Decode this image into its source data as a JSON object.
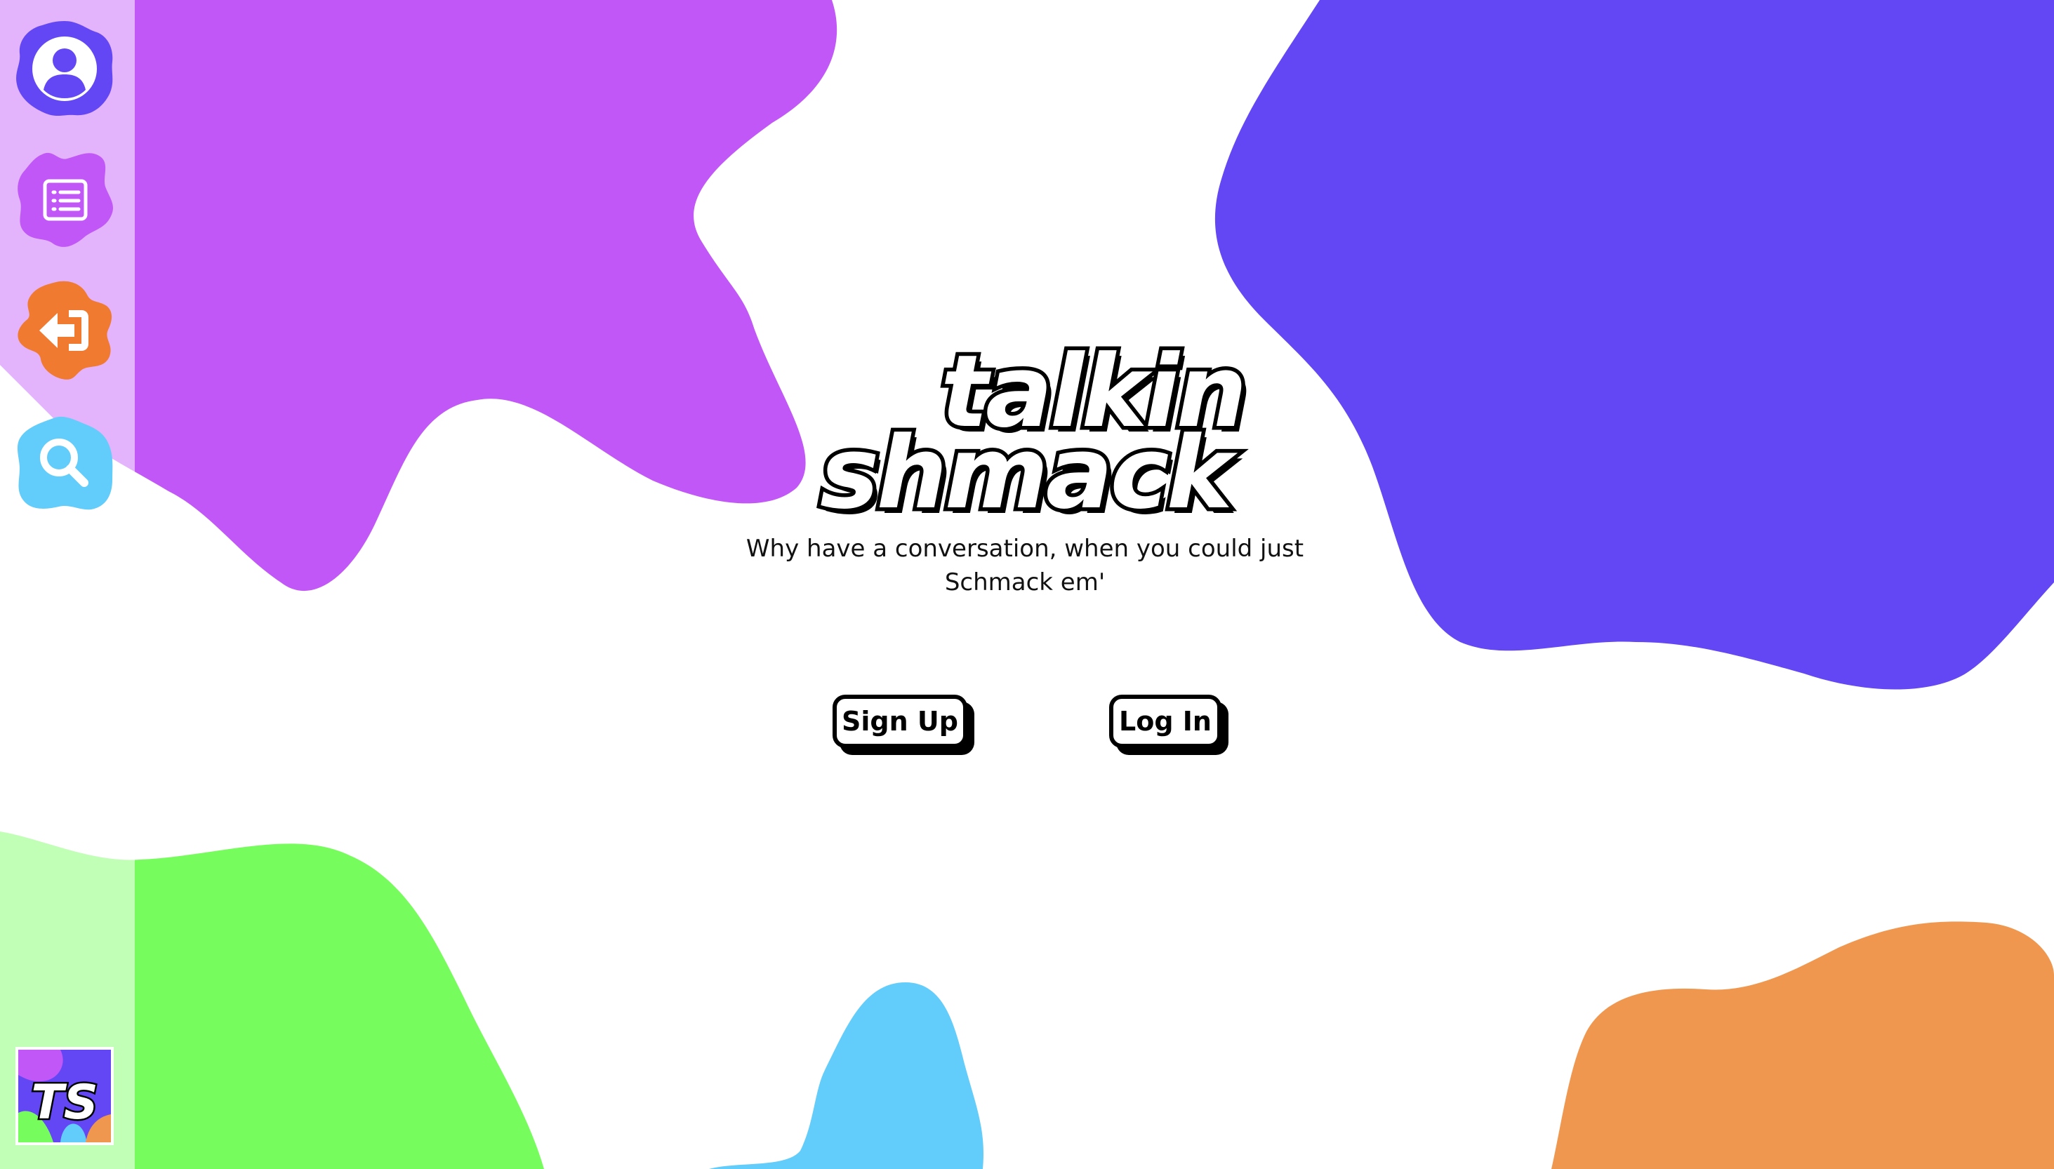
{
  "colors": {
    "purple": "#C157F7",
    "indigo": "#6447F4",
    "green": "#77FC5D",
    "sky": "#62CCFA",
    "orange": "#F0974F",
    "sidebar_tint": "rgba(255,255,255,0.55)"
  },
  "sidebar": {
    "items": [
      {
        "name": "profile",
        "icon": "user-icon",
        "color": "#6447F4"
      },
      {
        "name": "feed",
        "icon": "list-icon",
        "color": "#C157F7"
      },
      {
        "name": "logout",
        "icon": "exit-icon",
        "color": "#F07A30"
      },
      {
        "name": "search",
        "icon": "search-icon",
        "color": "#62CCFA"
      }
    ],
    "logo_text": "TS"
  },
  "hero": {
    "logo_line1": "talkin",
    "logo_line2": "shmack",
    "tagline_line1": "Why have a conversation, when you could just",
    "tagline_line2": "Schmack em'"
  },
  "actions": {
    "signup_label": "Sign Up",
    "login_label": "Log In"
  }
}
